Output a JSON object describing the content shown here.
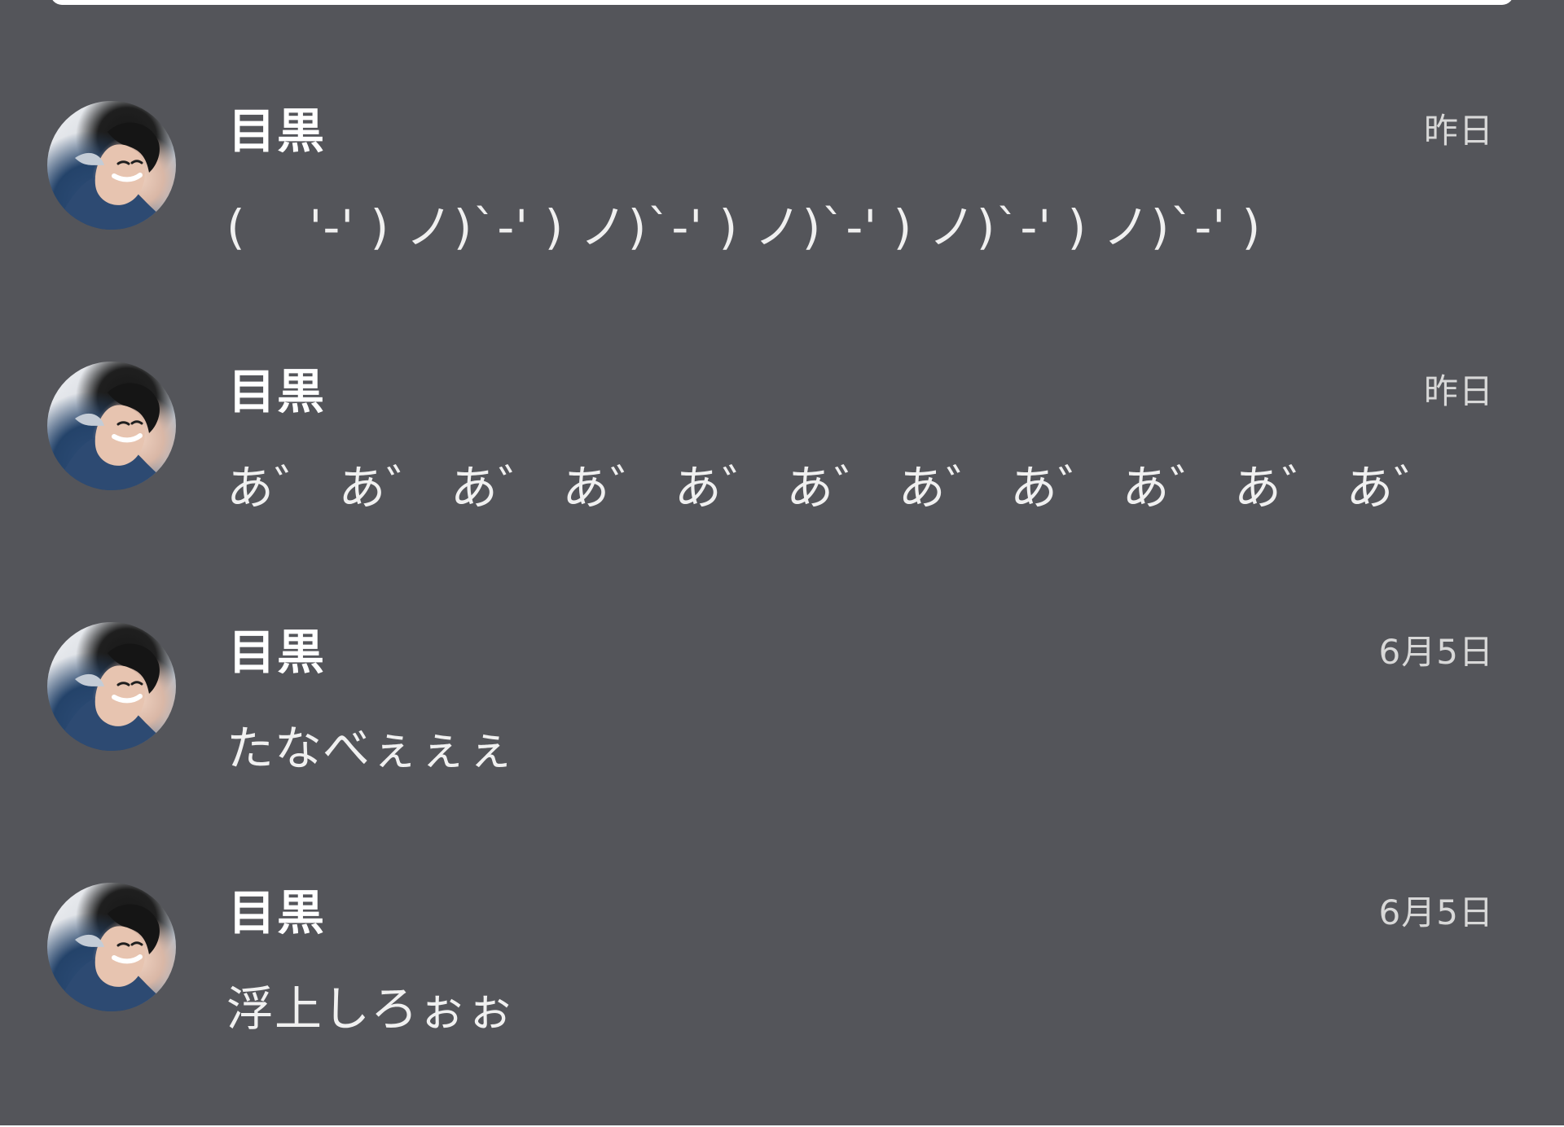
{
  "ui": {
    "colors": {
      "background": "#54555a",
      "author_text": "#ffffff",
      "message_text": "#f0f0f0",
      "timestamp_text": "#d8d8d8"
    }
  },
  "messages": [
    {
      "author": "目黒",
      "timestamp": "昨日",
      "text": "(    '-' ) ノ)`-' ) ノ)`-' ) ノ)`-' ) ノ)`-' ) ノ)`-' )",
      "avatar_icon": "avatar-photo"
    },
    {
      "author": "目黒",
      "timestamp": "昨日",
      "text": "あ゛ あ゛ あ゛ あ゛ あ゛ あ゛ あ゛ あ゛ あ゛ あ゛ あ゛",
      "avatar_icon": "avatar-photo"
    },
    {
      "author": "目黒",
      "timestamp": "6月5日",
      "text": "たなべぇぇぇ",
      "avatar_icon": "avatar-photo"
    },
    {
      "author": "目黒",
      "timestamp": "6月5日",
      "text": "浮上しろぉぉ",
      "avatar_icon": "avatar-photo"
    }
  ]
}
